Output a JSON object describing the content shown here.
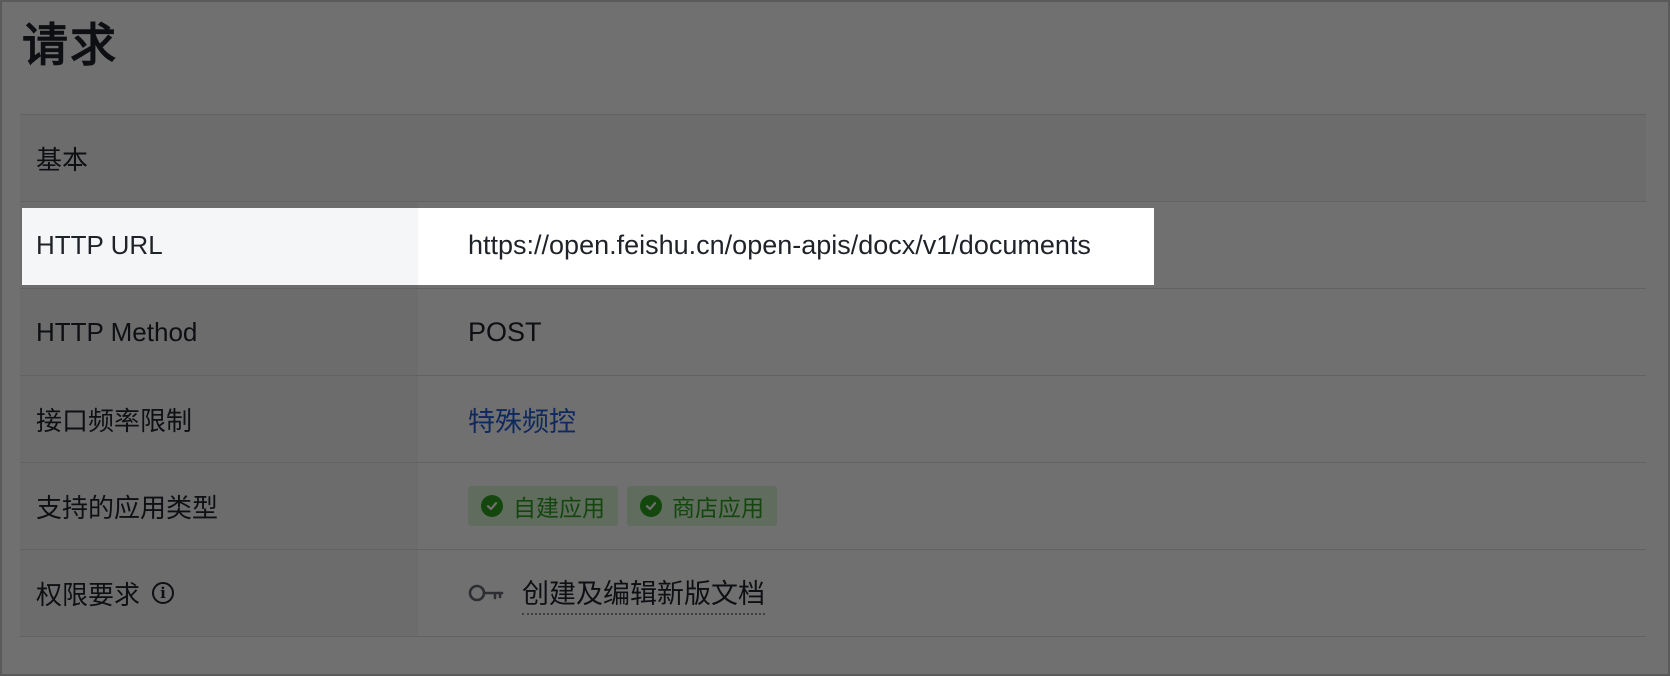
{
  "section_title": "请求",
  "table": {
    "header": "基本",
    "rows": {
      "url": {
        "label": "HTTP URL",
        "value": "https://open.feishu.cn/open-apis/docx/v1/documents"
      },
      "method": {
        "label": "HTTP Method",
        "value": "POST"
      },
      "rate_limit": {
        "label": "接口频率限制",
        "value": "特殊频控"
      },
      "app_types": {
        "label": "支持的应用类型",
        "tags": [
          "自建应用",
          "商店应用"
        ]
      },
      "permission": {
        "label": "权限要求",
        "value": "创建及编辑新版文档"
      }
    }
  },
  "colors": {
    "overlay": "#000000",
    "link": "#245bdb",
    "tag_bg": "#d9f5d6",
    "tag_text": "#2ea121"
  },
  "icons": [
    "check-circle-icon",
    "info-icon",
    "key-icon"
  ]
}
